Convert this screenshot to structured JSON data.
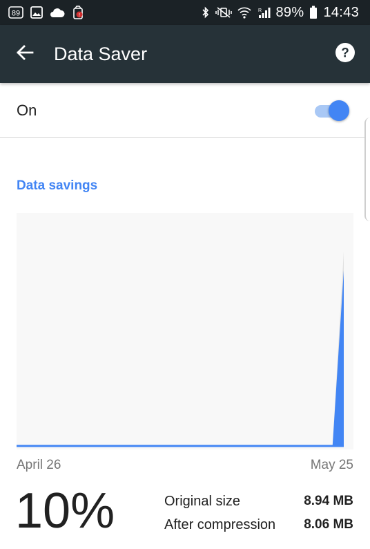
{
  "status_bar": {
    "left_icons": [
      "notification-count-icon",
      "gallery-icon",
      "cloud-icon",
      "app-alert-icon"
    ],
    "notification_count": "89",
    "battery_percent": "89%",
    "time": "14:43"
  },
  "app_bar": {
    "title": "Data Saver",
    "background": "#263238"
  },
  "toggle": {
    "label": "On",
    "state": "on",
    "accent": "#4285f4"
  },
  "section": {
    "title": "Data savings"
  },
  "chart_data": {
    "type": "area",
    "x_start_label": "April 26",
    "x_end_label": "May 25",
    "series": [
      {
        "values": [
          0,
          0,
          0,
          0,
          0,
          0,
          0,
          0,
          0,
          0,
          0,
          0,
          0,
          0,
          0,
          0,
          0,
          0,
          0,
          0,
          0,
          0,
          0,
          0,
          0,
          0,
          0,
          0,
          0,
          8.94
        ],
        "color": "#e0e0e0"
      },
      {
        "values": [
          0,
          0,
          0,
          0,
          0,
          0,
          0,
          0,
          0,
          0,
          0,
          0,
          0,
          0,
          0,
          0,
          0,
          0,
          0,
          0,
          0,
          0,
          0,
          0,
          0,
          0,
          0,
          0,
          0,
          8.06
        ],
        "color": "#4285f4"
      }
    ],
    "ylim": [
      0,
      10.7
    ]
  },
  "summary": {
    "percent": "10%",
    "original_label": "Original size",
    "original_value": "8.94 MB",
    "compressed_label": "After compression",
    "compressed_value": "8.06 MB"
  }
}
